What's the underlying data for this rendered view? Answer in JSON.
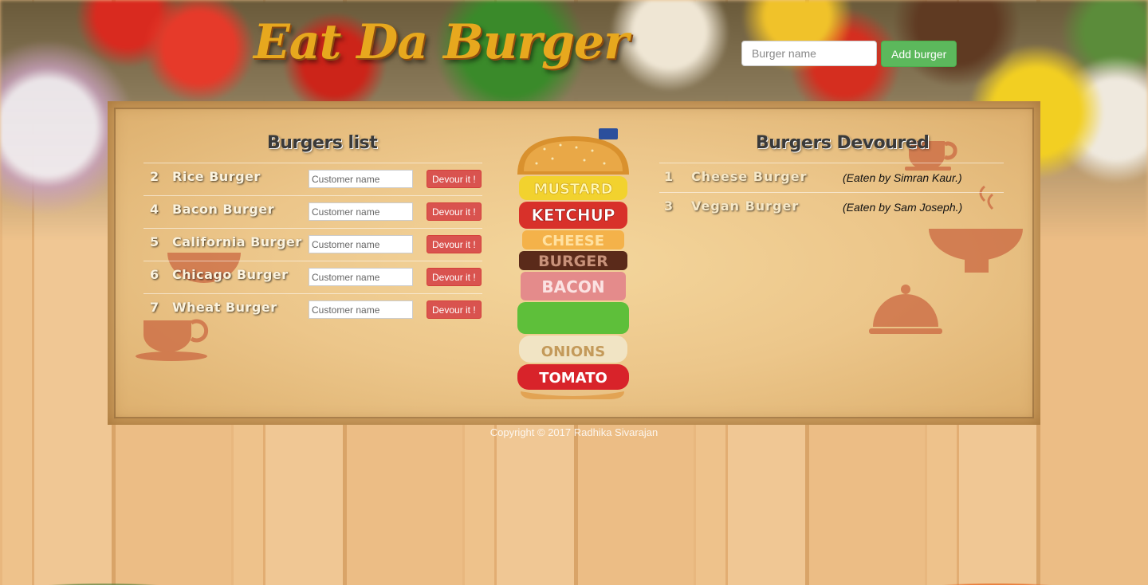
{
  "header": {
    "logo": "Eat Da Burger",
    "burger_input_placeholder": "Burger name",
    "add_button": "Add burger"
  },
  "burgers_list": {
    "title": "Burgers list",
    "customer_placeholder": "Customer name",
    "devour_label": "Devour it !",
    "items": [
      {
        "id": "2",
        "name": "Rice Burger"
      },
      {
        "id": "4",
        "name": "Bacon Burger"
      },
      {
        "id": "5",
        "name": "California Burger"
      },
      {
        "id": "6",
        "name": "Chicago Burger"
      },
      {
        "id": "7",
        "name": "Wheat Burger"
      }
    ]
  },
  "illustration": {
    "layers": [
      "MUSTARD",
      "KETCHUP",
      "CHEESE",
      "BURGER",
      "BACON",
      "ONIONS",
      "TOMATO"
    ]
  },
  "burgers_devoured": {
    "title": "Burgers Devoured",
    "items": [
      {
        "id": "1",
        "name": "Cheese Burger",
        "eaten_by": "(Eaten by Simran Kaur.)"
      },
      {
        "id": "3",
        "name": "Vegan Burger",
        "eaten_by": "(Eaten by Sam Joseph.)"
      }
    ]
  },
  "footer": {
    "copyright": "Copyright © 2017 Radhika Sivarajan"
  },
  "colors": {
    "logo": "#e7a81e",
    "add_button": "#5cb85c",
    "devour_button": "#d9534f",
    "panel": "#ecc68a"
  }
}
